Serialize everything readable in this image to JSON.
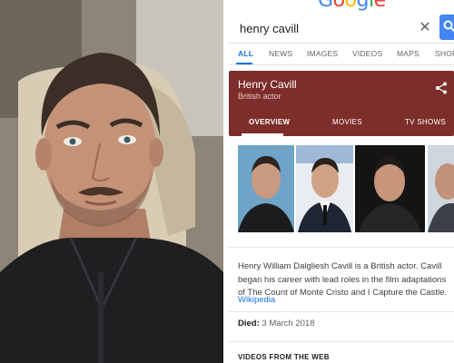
{
  "search": {
    "logo_letters": [
      "G",
      "o",
      "o",
      "g",
      "l",
      "e"
    ],
    "query": "henry cavill",
    "clear_icon": "close-icon",
    "submit_icon": "search-icon"
  },
  "tabs": [
    {
      "label": "ALL",
      "active": true
    },
    {
      "label": "NEWS",
      "active": false
    },
    {
      "label": "IMAGES",
      "active": false
    },
    {
      "label": "VIDEOS",
      "active": false
    },
    {
      "label": "MAPS",
      "active": false
    },
    {
      "label": "SHOP",
      "active": false
    }
  ],
  "knowledge_panel": {
    "title": "Henry Cavill",
    "subtitle": "British actor",
    "share_icon": "share-icon",
    "tabs": [
      {
        "label": "OVERVIEW",
        "active": true
      },
      {
        "label": "MOVIES",
        "active": false
      },
      {
        "label": "TV SHOWS",
        "active": false
      }
    ],
    "description": "Henry William Dalgliesh Cavill is a British actor. Cavill began his career with lead roles in the film adaptations of The Count of Monte Cristo and I Capture the Castle.",
    "source_link": "Wikipedia",
    "died_label": "Died:",
    "died_value": "3 March 2018"
  },
  "section_heading": "VIDEOS FROM THE WEB",
  "colors": {
    "panel": "#7d2d2a",
    "link": "#1a73e8",
    "google_blue": "#4285f4",
    "google_red": "#ea4335",
    "google_yellow": "#fbbc05",
    "google_green": "#34a853"
  }
}
